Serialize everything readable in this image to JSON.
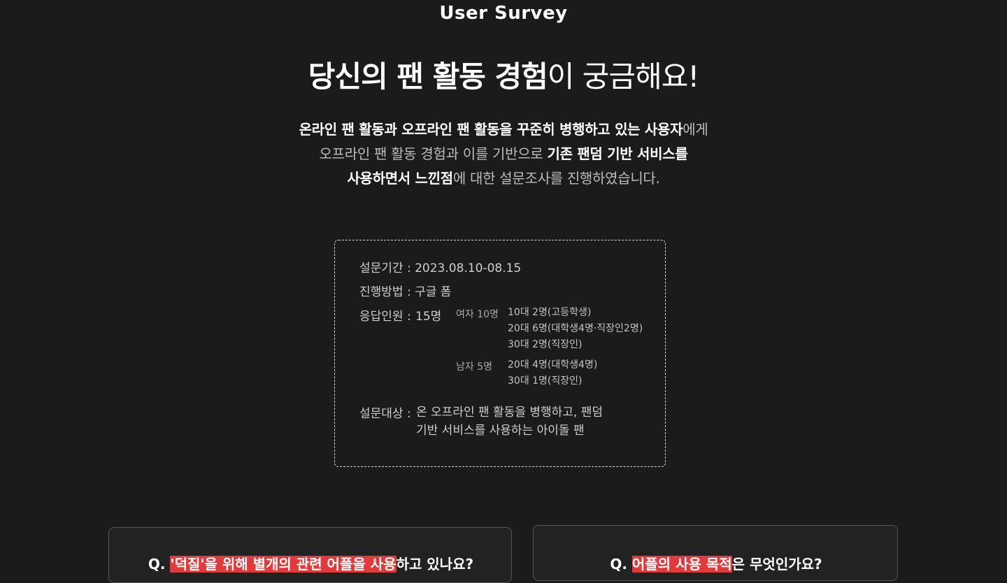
{
  "header": {
    "brand": "User Survey"
  },
  "hero": {
    "title_bold": "당신의 팬 활동 경험",
    "title_light": "이 궁금해요!"
  },
  "intro": {
    "line1_bold": "온라인 팬 활동과 오프라인 팬 활동을 꾸준히 병행하고 있는 사용자",
    "line1_light": "에게",
    "line2_light": "오프라인 팬 활동 경험과 이를 기반으로 ",
    "line2_bold": "기존 팬덤 기반 서비스를",
    "line3_bold": "사용하면서 느낀점",
    "line3_light": "에 대한 설문조사를 진행하였습니다."
  },
  "survey_info": {
    "period": "설문기간 : 2023.08.10-08.15",
    "method": "진행방법 : 구글 폼",
    "respondents_label": "응답인원 :",
    "respondents_count": "15명",
    "female": {
      "label": "여자 10명",
      "details": [
        "10대 2명(고등학생)",
        "20대 6명(대학생4명·직장인2명)",
        "30대 2명(직장인)"
      ]
    },
    "male": {
      "label": "남자 5명",
      "details": [
        "20대 4명(대학생4명)",
        "30대 1명(직장인)"
      ]
    },
    "target_label": "설문대상 :",
    "target_line1": "온 오프라인 팬 활동을 병행하고, 팬덤",
    "target_line2": "기반 서비스를 사용하는 아이돌 팬"
  },
  "questions": [
    {
      "prefix": "Q. ",
      "highlight": "'덕질'을 위해 별개의 관련 어플을 사용",
      "suffix": "하고 있나요?"
    },
    {
      "prefix": "Q. ",
      "highlight": "어플의 사용 목적",
      "suffix": "은 무엇인가요?"
    }
  ],
  "colors": {
    "background": "#1b1b1b",
    "highlight": "#e23a3a",
    "card_border": "#d8d8d8"
  }
}
